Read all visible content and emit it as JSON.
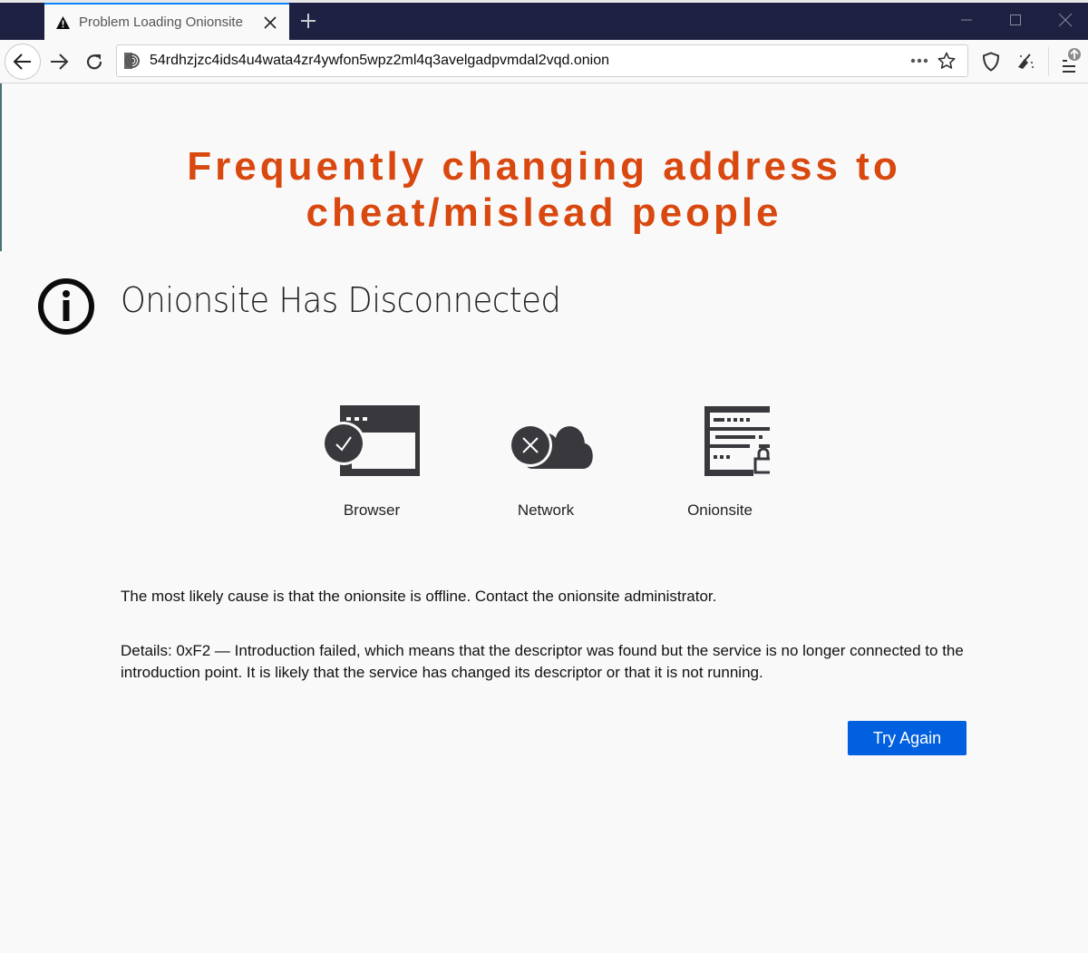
{
  "browser": {
    "tab": {
      "title": "Problem Loading Onionsite",
      "icon": "warning-icon"
    },
    "new_tab_label": "+",
    "window_controls": [
      "minimize",
      "maximize",
      "close"
    ],
    "address_bar": {
      "url": "54rdhzjzc4ids4u4wata4zr4ywfon5wpz2ml4q3avelgadpvmdal2vqd.onion",
      "identity_icon": "onion-icon"
    },
    "toolbar_icons": [
      "back-icon",
      "forward-icon",
      "reload-icon",
      "page-actions-icon",
      "bookmark-star-icon",
      "shield-icon",
      "new-identity-broom-icon",
      "menu-icon"
    ],
    "update_badge": "arrow-up"
  },
  "overlay": {
    "headline_line1": "Frequently changing address to",
    "headline_line2": "cheat/mislead people",
    "color": "#d9480f"
  },
  "error_page": {
    "title": "Onionsite Has Disconnected",
    "status": [
      {
        "label": "Browser",
        "state": "ok"
      },
      {
        "label": "Network",
        "state": "error"
      },
      {
        "label": "Onionsite",
        "state": "unknown"
      }
    ],
    "description": "The most likely cause is that the onionsite is offline. Contact the onionsite administrator.",
    "details": "Details: 0xF2 — Introduction failed, which means that the descriptor was found but the service is no longer connected to the introduction point. It is likely that the service has changed its descriptor or that it is not running.",
    "try_again_label": "Try Again",
    "accent_color": "#0060df"
  }
}
